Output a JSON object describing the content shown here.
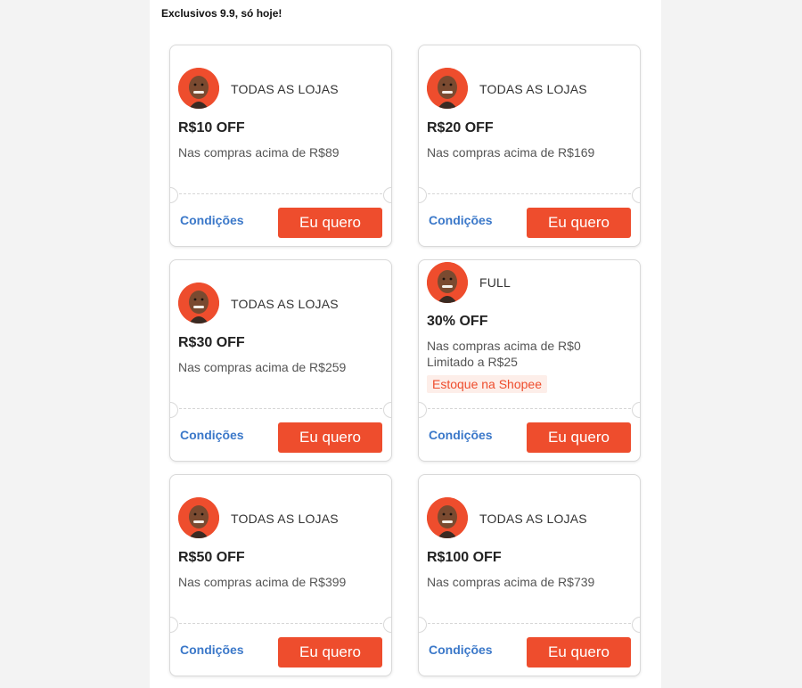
{
  "page": {
    "heading": "Exclusivos 9.9, só hoje!"
  },
  "coupons": [
    {
      "store": "TODAS AS LOJAS",
      "amount": "R$10 OFF",
      "min_purchase": "Nas compras acima de R$89",
      "conditions_label": "Condições",
      "cta_label": "Eu quero"
    },
    {
      "store": "TODAS AS LOJAS",
      "amount": "R$20 OFF",
      "min_purchase": "Nas compras acima de R$169",
      "conditions_label": "Condições",
      "cta_label": "Eu quero"
    },
    {
      "store": "TODAS AS LOJAS",
      "amount": "R$30 OFF",
      "min_purchase": "Nas compras acima de R$259",
      "conditions_label": "Condições",
      "cta_label": "Eu quero"
    },
    {
      "store": "FULL",
      "amount": "30% OFF",
      "min_purchase": "Nas compras acima de R$0",
      "limit": "Limitado a R$25",
      "tag": "Estoque na Shopee",
      "conditions_label": "Condições",
      "cta_label": "Eu quero"
    },
    {
      "store": "TODAS AS LOJAS",
      "amount": "R$50 OFF",
      "min_purchase": "Nas compras acima de R$399",
      "conditions_label": "Condições",
      "cta_label": "Eu quero"
    },
    {
      "store": "TODAS AS LOJAS",
      "amount": "R$100 OFF",
      "min_purchase": "Nas compras acima de R$739",
      "conditions_label": "Condições",
      "cta_label": "Eu quero"
    }
  ],
  "colors": {
    "accent": "#ee4d2d",
    "link": "#3b78c9",
    "tag_bg": "#fdeee9"
  },
  "icons": {
    "avatar": "person-portrait-icon"
  }
}
